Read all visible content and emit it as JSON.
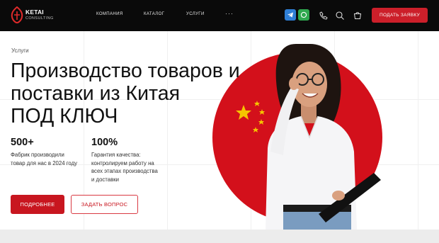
{
  "header": {
    "logo": {
      "name": "KETAI",
      "sub": "CONSULTING"
    },
    "nav": [
      "КОМПАНИЯ",
      "КАТАЛОГ",
      "УСЛУГИ"
    ],
    "more": "···",
    "cta": "ПОДАТЬ ЗАЯВКУ"
  },
  "hero": {
    "breadcrumb": "Услуги",
    "title_lines": [
      "Производство товаров и",
      "поставки из Китая",
      "ПОД КЛЮЧ"
    ],
    "stats": [
      {
        "value": "500+",
        "text_lines": [
          "Фабрик производили",
          "товар для нас в 2024 году"
        ]
      },
      {
        "value": "100%",
        "text_lines": [
          "Гарантия качества:",
          "контролируем работу на",
          "всех этапах производства",
          "и доставки"
        ]
      }
    ],
    "primary_button": "ПОДРОБНЕЕ",
    "secondary_button": "ЗАДАТЬ ВОПРОС"
  },
  "colors": {
    "accent": "#c8161f",
    "header_bg": "#0a0a0a",
    "flag_star": "#f5c400"
  },
  "icons": [
    "telegram-icon",
    "whatsapp-icon",
    "phone-icon",
    "search-icon",
    "cart-icon"
  ]
}
